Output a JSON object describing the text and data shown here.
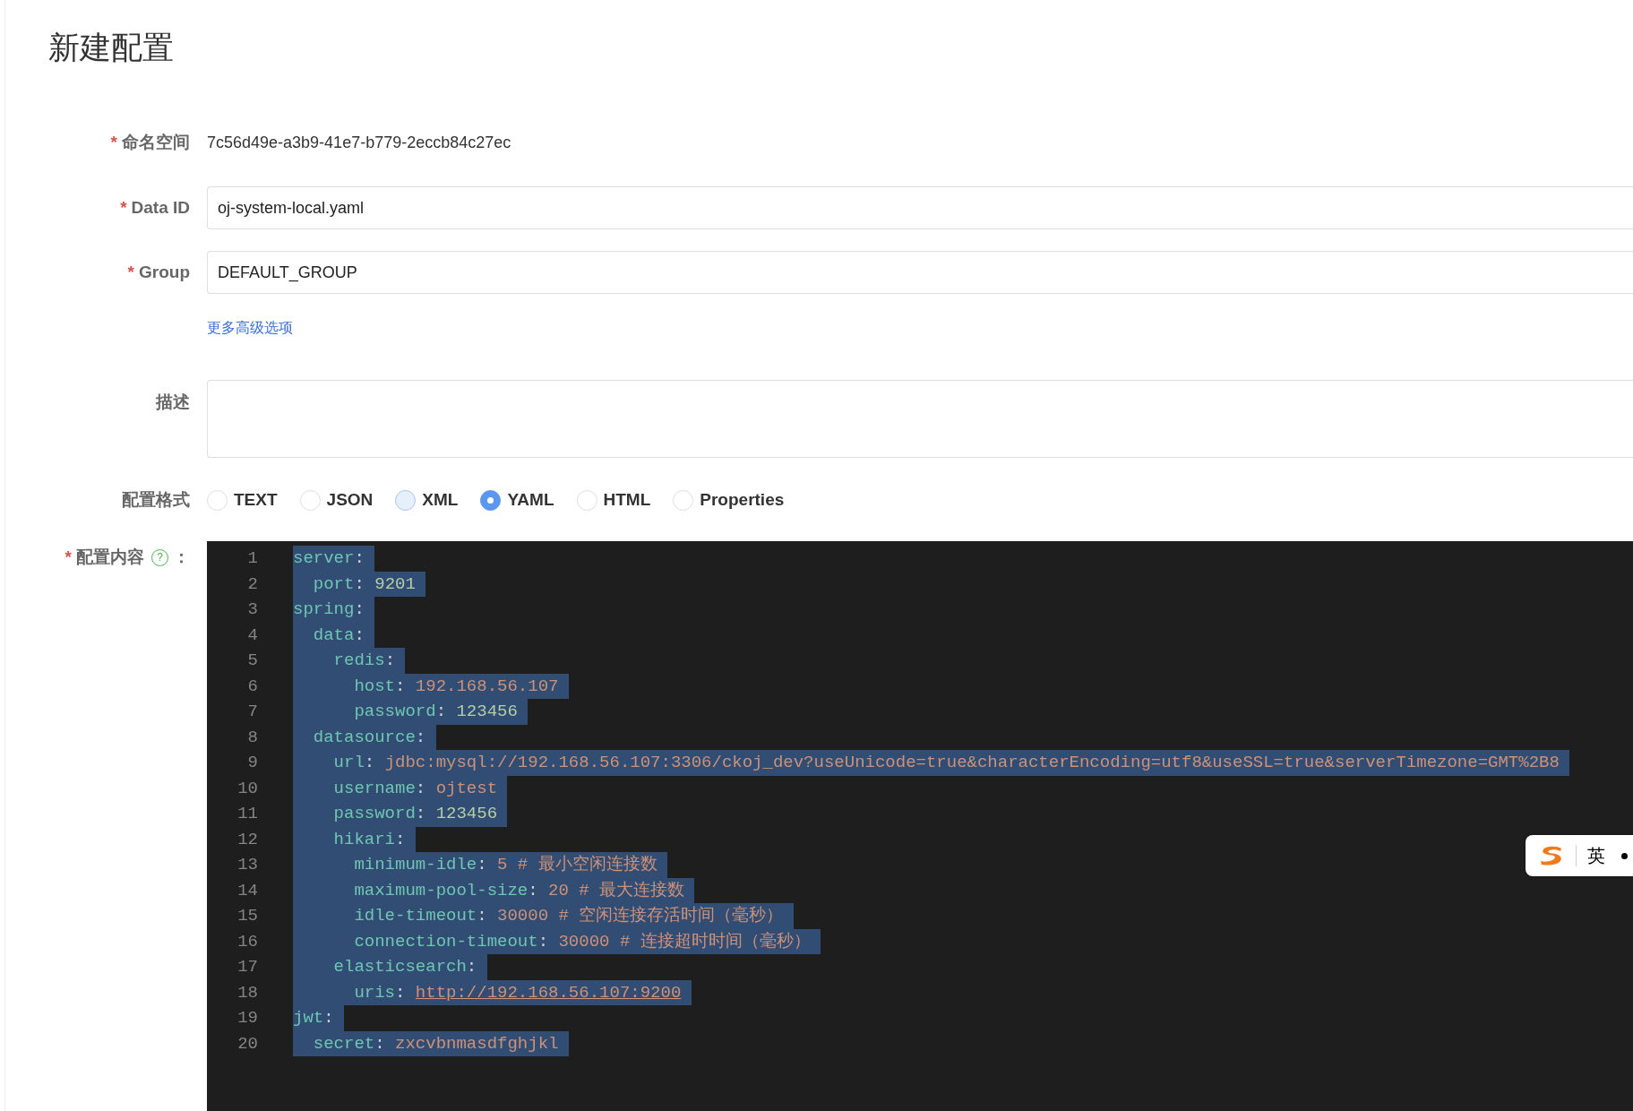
{
  "title": "新建配置",
  "fields": [
    {
      "kind": "static",
      "label": "命名空间",
      "required_mark": "*",
      "value": "7c56d49e-a3b9-41e7-b779-2eccb84c27ec"
    },
    {
      "kind": "input",
      "label": "Data ID",
      "required_mark": "*",
      "value": "oj-system-local.yaml"
    },
    {
      "kind": "input",
      "label": "Group",
      "required_mark": "*",
      "value": "DEFAULT_GROUP"
    },
    {
      "kind": "link",
      "text": "更多高级选项"
    },
    {
      "kind": "textarea",
      "label": "描述"
    },
    {
      "kind": "radios",
      "label": "配置格式",
      "options": [
        {
          "label": "TEXT",
          "selected": false
        },
        {
          "label": "JSON",
          "selected": false
        },
        {
          "label": "XML",
          "selected": false,
          "hovered": true
        },
        {
          "label": "YAML",
          "selected": true
        },
        {
          "label": "HTML",
          "selected": false
        },
        {
          "label": "Properties",
          "selected": false
        }
      ]
    }
  ],
  "editor": {
    "label": "配置内容",
    "required_mark": "*",
    "help_icon": "?",
    "colon": "：",
    "lines": [
      {
        "number": "1",
        "selected": true,
        "tokens": [
          {
            "kind": "key",
            "text": "server"
          },
          {
            "kind": "punct",
            "text": ":"
          }
        ]
      },
      {
        "number": "2",
        "selected": true,
        "tokens": [
          {
            "kind": "key",
            "text": "  port"
          },
          {
            "kind": "punct",
            "text": ": "
          },
          {
            "kind": "number",
            "text": "9201"
          }
        ]
      },
      {
        "number": "3",
        "selected": true,
        "tokens": [
          {
            "kind": "key",
            "text": "spring"
          },
          {
            "kind": "punct",
            "text": ":"
          }
        ]
      },
      {
        "number": "4",
        "selected": true,
        "tokens": [
          {
            "kind": "key",
            "text": "  data"
          },
          {
            "kind": "punct",
            "text": ":"
          }
        ]
      },
      {
        "number": "5",
        "selected": true,
        "tokens": [
          {
            "kind": "key",
            "text": "    redis"
          },
          {
            "kind": "punct",
            "text": ":"
          }
        ]
      },
      {
        "number": "6",
        "selected": true,
        "tokens": [
          {
            "kind": "key",
            "text": "      host"
          },
          {
            "kind": "punct",
            "text": ": "
          },
          {
            "kind": "string",
            "text": "192.168.56.107"
          }
        ]
      },
      {
        "number": "7",
        "selected": true,
        "tokens": [
          {
            "kind": "key",
            "text": "      password"
          },
          {
            "kind": "punct",
            "text": ": "
          },
          {
            "kind": "number",
            "text": "123456"
          }
        ]
      },
      {
        "number": "8",
        "selected": true,
        "tokens": [
          {
            "kind": "key",
            "text": "  datasource"
          },
          {
            "kind": "punct",
            "text": ":"
          }
        ]
      },
      {
        "number": "9",
        "selected": true,
        "tokens": [
          {
            "kind": "key",
            "text": "    url"
          },
          {
            "kind": "punct",
            "text": ": "
          },
          {
            "kind": "string",
            "text": "jdbc:mysql://192.168.56.107:3306/ckoj_dev?useUnicode=true&characterEncoding=utf8&useSSL=true&serverTimezone=GMT%2B8"
          }
        ]
      },
      {
        "number": "10",
        "selected": true,
        "tokens": [
          {
            "kind": "key",
            "text": "    username"
          },
          {
            "kind": "punct",
            "text": ": "
          },
          {
            "kind": "string",
            "text": "ojtest"
          }
        ]
      },
      {
        "number": "11",
        "selected": true,
        "tokens": [
          {
            "kind": "key",
            "text": "    password"
          },
          {
            "kind": "punct",
            "text": ": "
          },
          {
            "kind": "number",
            "text": "123456"
          }
        ]
      },
      {
        "number": "12",
        "selected": true,
        "tokens": [
          {
            "kind": "key",
            "text": "    hikari"
          },
          {
            "kind": "punct",
            "text": ":"
          }
        ]
      },
      {
        "number": "13",
        "selected": true,
        "tokens": [
          {
            "kind": "key",
            "text": "      minimum-idle"
          },
          {
            "kind": "punct",
            "text": ": "
          },
          {
            "kind": "string",
            "text": "5 # 最小空闲连接数"
          }
        ]
      },
      {
        "number": "14",
        "selected": true,
        "tokens": [
          {
            "kind": "key",
            "text": "      maximum-pool-size"
          },
          {
            "kind": "punct",
            "text": ": "
          },
          {
            "kind": "string",
            "text": "20 # 最大连接数"
          }
        ]
      },
      {
        "number": "15",
        "selected": true,
        "tokens": [
          {
            "kind": "key",
            "text": "      idle-timeout"
          },
          {
            "kind": "punct",
            "text": ": "
          },
          {
            "kind": "string",
            "text": "30000 # 空闲连接存活时间（毫秒）"
          }
        ]
      },
      {
        "number": "16",
        "selected": true,
        "tokens": [
          {
            "kind": "key",
            "text": "      connection-timeout"
          },
          {
            "kind": "punct",
            "text": ": "
          },
          {
            "kind": "string",
            "text": "30000 # 连接超时时间（毫秒）"
          }
        ]
      },
      {
        "number": "17",
        "selected": true,
        "tokens": [
          {
            "kind": "key",
            "text": "    elasticsearch"
          },
          {
            "kind": "punct",
            "text": ":"
          }
        ]
      },
      {
        "number": "18",
        "selected": true,
        "tokens": [
          {
            "kind": "key",
            "text": "      uris"
          },
          {
            "kind": "punct",
            "text": ": "
          },
          {
            "kind": "link",
            "text": "http://192.168.56.107:9200"
          }
        ]
      },
      {
        "number": "19",
        "selected": true,
        "tokens": [
          {
            "kind": "key",
            "text": "jwt"
          },
          {
            "kind": "punct",
            "text": ":"
          }
        ]
      },
      {
        "number": "20",
        "selected": true,
        "tokens": [
          {
            "kind": "key",
            "text": "  secret"
          },
          {
            "kind": "punct",
            "text": ": "
          },
          {
            "kind": "string",
            "text": "zxcvbnmasdfghjkl"
          }
        ]
      }
    ]
  },
  "ime_toolbar": {
    "mode": "英"
  }
}
